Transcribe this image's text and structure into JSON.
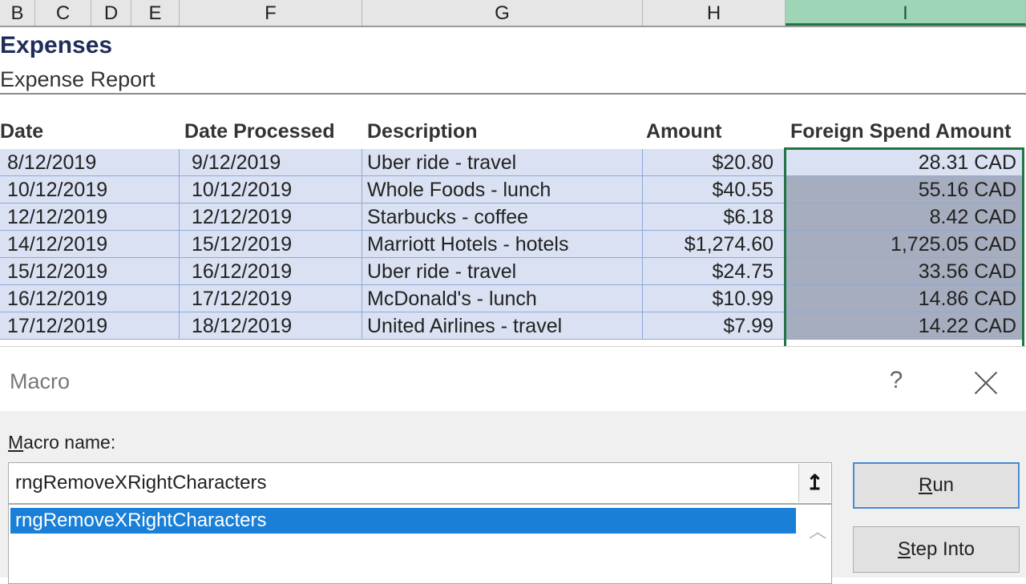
{
  "columns": [
    "B",
    "C",
    "D",
    "E",
    "F",
    "G",
    "H",
    "I"
  ],
  "sheet": {
    "title": "Expenses",
    "subtitle": "Expense Report",
    "headers": {
      "date": "Date",
      "date_processed": "Date Processed",
      "description": "Description",
      "amount": "Amount",
      "foreign": "Foreign Spend Amount"
    },
    "rows": [
      {
        "date": "8/12/2019",
        "processed": "9/12/2019",
        "description": "Uber ride - travel",
        "amount": "$20.80",
        "foreign": "28.31 CAD"
      },
      {
        "date": "10/12/2019",
        "processed": "10/12/2019",
        "description": "Whole Foods - lunch",
        "amount": "$40.55",
        "foreign": "55.16 CAD"
      },
      {
        "date": "12/12/2019",
        "processed": "12/12/2019",
        "description": "Starbucks - coffee",
        "amount": "$6.18",
        "foreign": "8.42 CAD"
      },
      {
        "date": "14/12/2019",
        "processed": "15/12/2019",
        "description": "Marriott Hotels - hotels",
        "amount": "$1,274.60",
        "foreign": "1,725.05 CAD"
      },
      {
        "date": "15/12/2019",
        "processed": "16/12/2019",
        "description": "Uber ride - travel",
        "amount": "$24.75",
        "foreign": "33.56 CAD"
      },
      {
        "date": "16/12/2019",
        "processed": "17/12/2019",
        "description": "McDonald's - lunch",
        "amount": "$10.99",
        "foreign": "14.86 CAD"
      },
      {
        "date": "17/12/2019",
        "processed": "18/12/2019",
        "description": "United Airlines - travel",
        "amount": "$7.99",
        "foreign": "14.22 CAD"
      }
    ]
  },
  "dialog": {
    "title": "Macro",
    "help": "?",
    "macro_name_label_first": "M",
    "macro_name_label_rest": "acro name:",
    "macro_name_value": "rngRemoveXRightCharacters",
    "list_items": [
      "rngRemoveXRightCharacters"
    ],
    "ref_icon": "↥",
    "run_first": "R",
    "run_rest": "un",
    "step_first": "S",
    "step_rest": "tep Into"
  },
  "colors": {
    "table_fill": "#d9e1f2",
    "selected_fill": "#a6adbe",
    "selection_border": "#217346",
    "list_highlight": "#1a7fd6"
  }
}
